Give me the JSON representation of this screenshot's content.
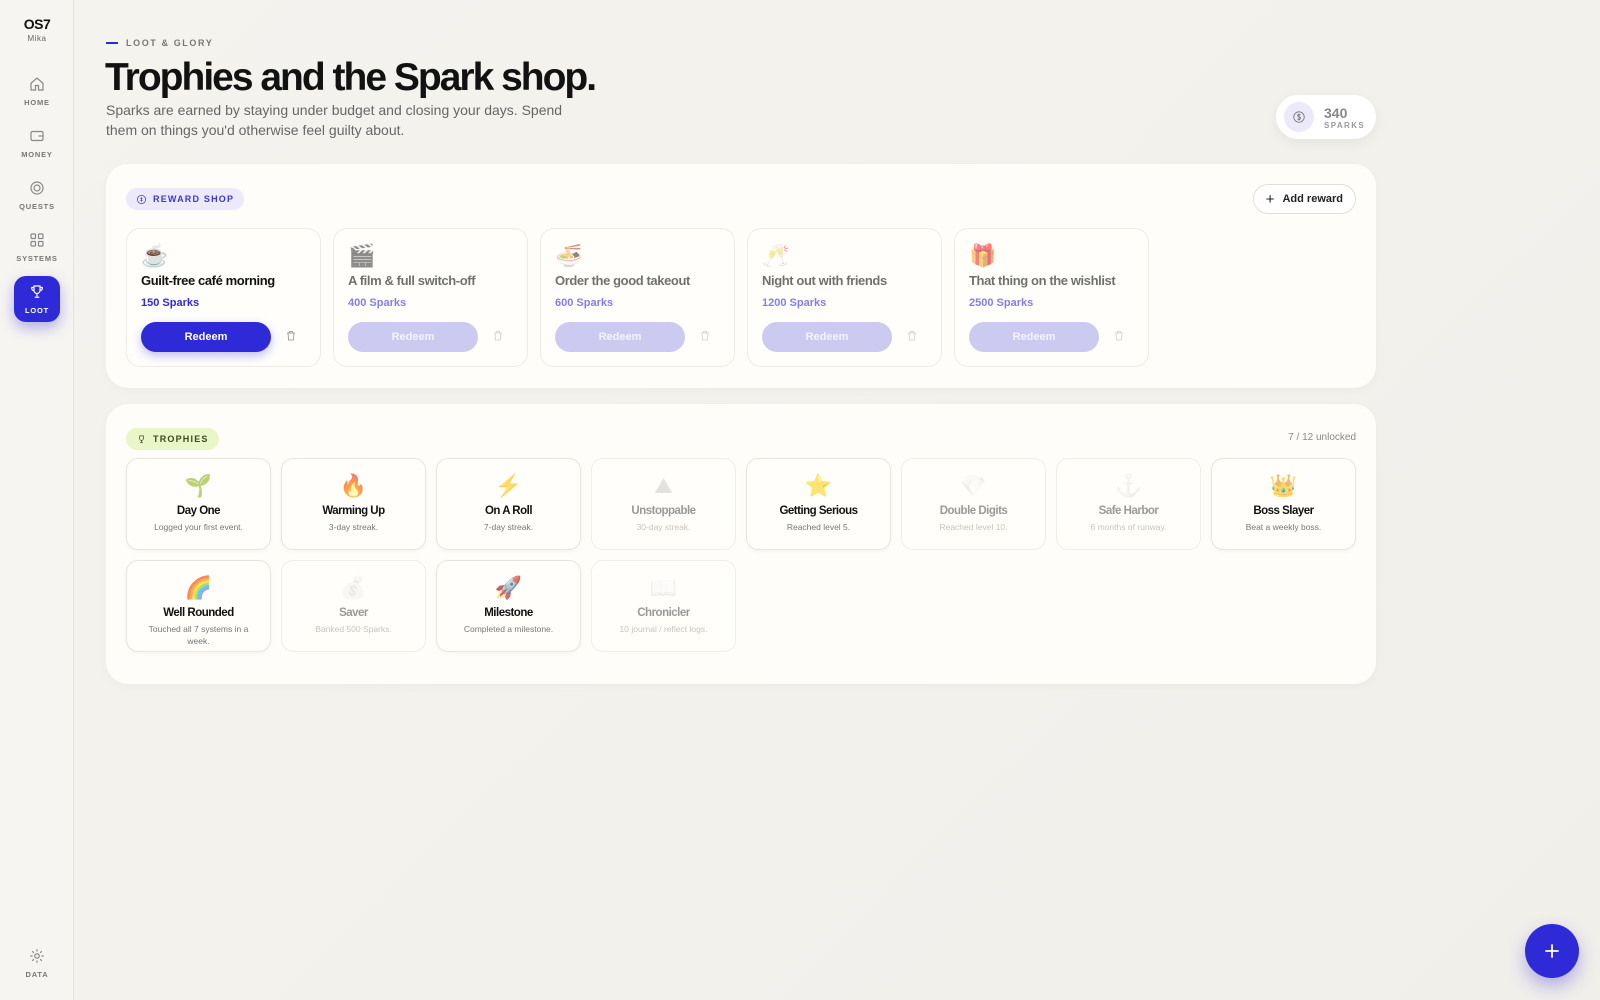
{
  "app": {
    "logo": "OS7",
    "user": "Mika"
  },
  "nav": {
    "items": [
      {
        "label": "HOME",
        "icon": "home-icon"
      },
      {
        "label": "MONEY",
        "icon": "wallet-icon"
      },
      {
        "label": "QUESTS",
        "icon": "target-icon"
      },
      {
        "label": "SYSTEMS",
        "icon": "grid-icon"
      },
      {
        "label": "LOOT",
        "icon": "trophy-icon",
        "active": true
      }
    ],
    "data_label": "DATA"
  },
  "header": {
    "eyebrow": "LOOT & GLORY",
    "title": "Trophies and the Spark shop.",
    "subtitle": "Sparks are earned by staying under budget and closing your days. Spend them on things you'd otherwise feel guilty about."
  },
  "balance": {
    "amount": "340",
    "unit": "SPARKS"
  },
  "shop": {
    "chip": "REWARD SHOP",
    "add_label": "Add reward",
    "redeem_label": "Redeem",
    "rewards": [
      {
        "icon": "☕",
        "name": "Guilt-free café morning",
        "cost": "150 Sparks",
        "affordable": true
      },
      {
        "icon": "🎬",
        "name": "A film & full switch-off",
        "cost": "400 Sparks",
        "affordable": false
      },
      {
        "icon": "🍜",
        "name": "Order the good takeout",
        "cost": "600 Sparks",
        "affordable": false
      },
      {
        "icon": "🥂",
        "name": "Night out with friends",
        "cost": "1200 Sparks",
        "affordable": false
      },
      {
        "icon": "🎁",
        "name": "That thing on the wishlist",
        "cost": "2500 Sparks",
        "affordable": false
      }
    ]
  },
  "trophies": {
    "chip": "TROPHIES",
    "count": "7 / 12 unlocked",
    "items": [
      {
        "icon": "🌱",
        "name": "Day One",
        "desc": "Logged your first event.",
        "unlocked": true
      },
      {
        "icon": "🔥",
        "name": "Warming Up",
        "desc": "3-day streak.",
        "unlocked": true
      },
      {
        "icon": "⚡",
        "name": "On A Roll",
        "desc": "7-day streak.",
        "unlocked": true
      },
      {
        "icon": "⛰",
        "name": "Unstoppable",
        "desc": "30-day streak.",
        "unlocked": false
      },
      {
        "icon": "⭐",
        "name": "Getting Serious",
        "desc": "Reached level 5.",
        "unlocked": true
      },
      {
        "icon": "💎",
        "name": "Double Digits",
        "desc": "Reached level 10.",
        "unlocked": false
      },
      {
        "icon": "⚓",
        "name": "Safe Harbor",
        "desc": "6 months of runway.",
        "unlocked": false
      },
      {
        "icon": "👑",
        "name": "Boss Slayer",
        "desc": "Beat a weekly boss.",
        "unlocked": true
      },
      {
        "icon": "🌈",
        "name": "Well Rounded",
        "desc": "Touched all 7 systems in a week.",
        "unlocked": true
      },
      {
        "icon": "💰",
        "name": "Saver",
        "desc": "Banked 500 Sparks.",
        "unlocked": false
      },
      {
        "icon": "🚀",
        "name": "Milestone",
        "desc": "Completed a milestone.",
        "unlocked": true
      },
      {
        "icon": "📖",
        "name": "Chronicler",
        "desc": "10 journal / reflect logs.",
        "unlocked": false
      }
    ]
  },
  "colors": {
    "accent": "#2f2ad8",
    "accent_soft": "#cdcaf2",
    "trophy_chip": "#e9f6c8"
  }
}
